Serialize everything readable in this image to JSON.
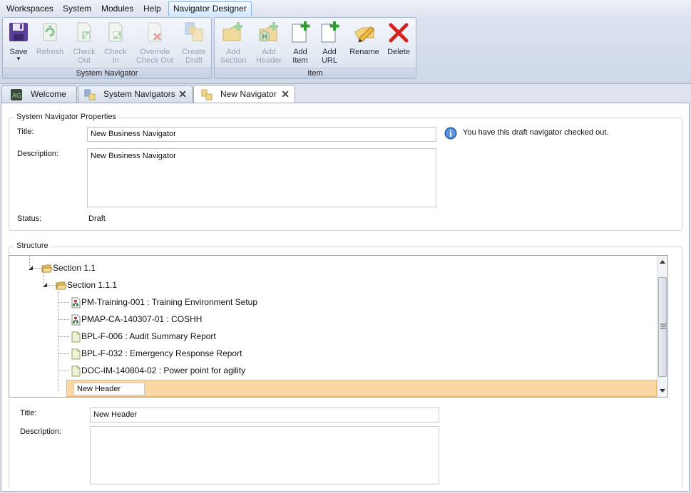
{
  "menu": {
    "items": [
      "Workspaces",
      "System",
      "Modules",
      "Help"
    ],
    "active_tab": "Navigator Designer"
  },
  "ribbon": {
    "system_group": {
      "label": "System Navigator",
      "save": "Save",
      "refresh": "Refresh",
      "check_out": [
        "Check",
        "Out"
      ],
      "check_in": [
        "Check",
        "In"
      ],
      "override": [
        "Override",
        "Check Out"
      ],
      "create_draft": [
        "Create",
        "Draft"
      ]
    },
    "item_group": {
      "label": "Item",
      "add_section": [
        "Add",
        "Section"
      ],
      "add_header": [
        "Add",
        "Header"
      ],
      "add_item": [
        "Add",
        "Item"
      ],
      "add_url": [
        "Add",
        "URL"
      ],
      "rename": "Rename",
      "delete": "Delete"
    }
  },
  "tabs": [
    {
      "label": "Welcome",
      "icon": "ag-logo-icon",
      "closable": false
    },
    {
      "label": "System Navigators",
      "icon": "navigator-icon",
      "closable": true
    },
    {
      "label": "New Navigator",
      "icon": "navigator-icon",
      "closable": true,
      "active": true
    }
  ],
  "properties": {
    "legend": "System Navigator Properties",
    "title_label": "Title:",
    "title_value": "New Business Navigator",
    "description_label": "Description:",
    "description_value": "New Business Navigator",
    "status_label": "Status:",
    "status_value": "Draft",
    "info_message": "You have this draft navigator checked out."
  },
  "structure": {
    "legend": "Structure",
    "nodes": [
      {
        "label": "Section 1.1",
        "type": "folder"
      },
      {
        "label": "Section 1.1.1",
        "type": "folder"
      },
      {
        "label": "PM-Training-001 : Training Environment Setup",
        "type": "process"
      },
      {
        "label": "PMAP-CA-140307-01 : COSHH",
        "type": "process"
      },
      {
        "label": "BPL-F-006 : Audit Summary Report",
        "type": "document"
      },
      {
        "label": "BPL-F-032 : Emergency Response Report",
        "type": "document"
      },
      {
        "label": "DOC-IM-140804-02 : Power point for agility",
        "type": "document"
      },
      {
        "label": "New Header",
        "type": "header-edit"
      }
    ]
  },
  "item_details": {
    "title_label": "Title:",
    "title_value": "New Header",
    "description_label": "Description:",
    "description_value": ""
  },
  "colors": {
    "selection": "#f9d8a5",
    "accent": "#3a6ea5",
    "delete_red": "#d42323",
    "add_green": "#2e9d2e"
  }
}
